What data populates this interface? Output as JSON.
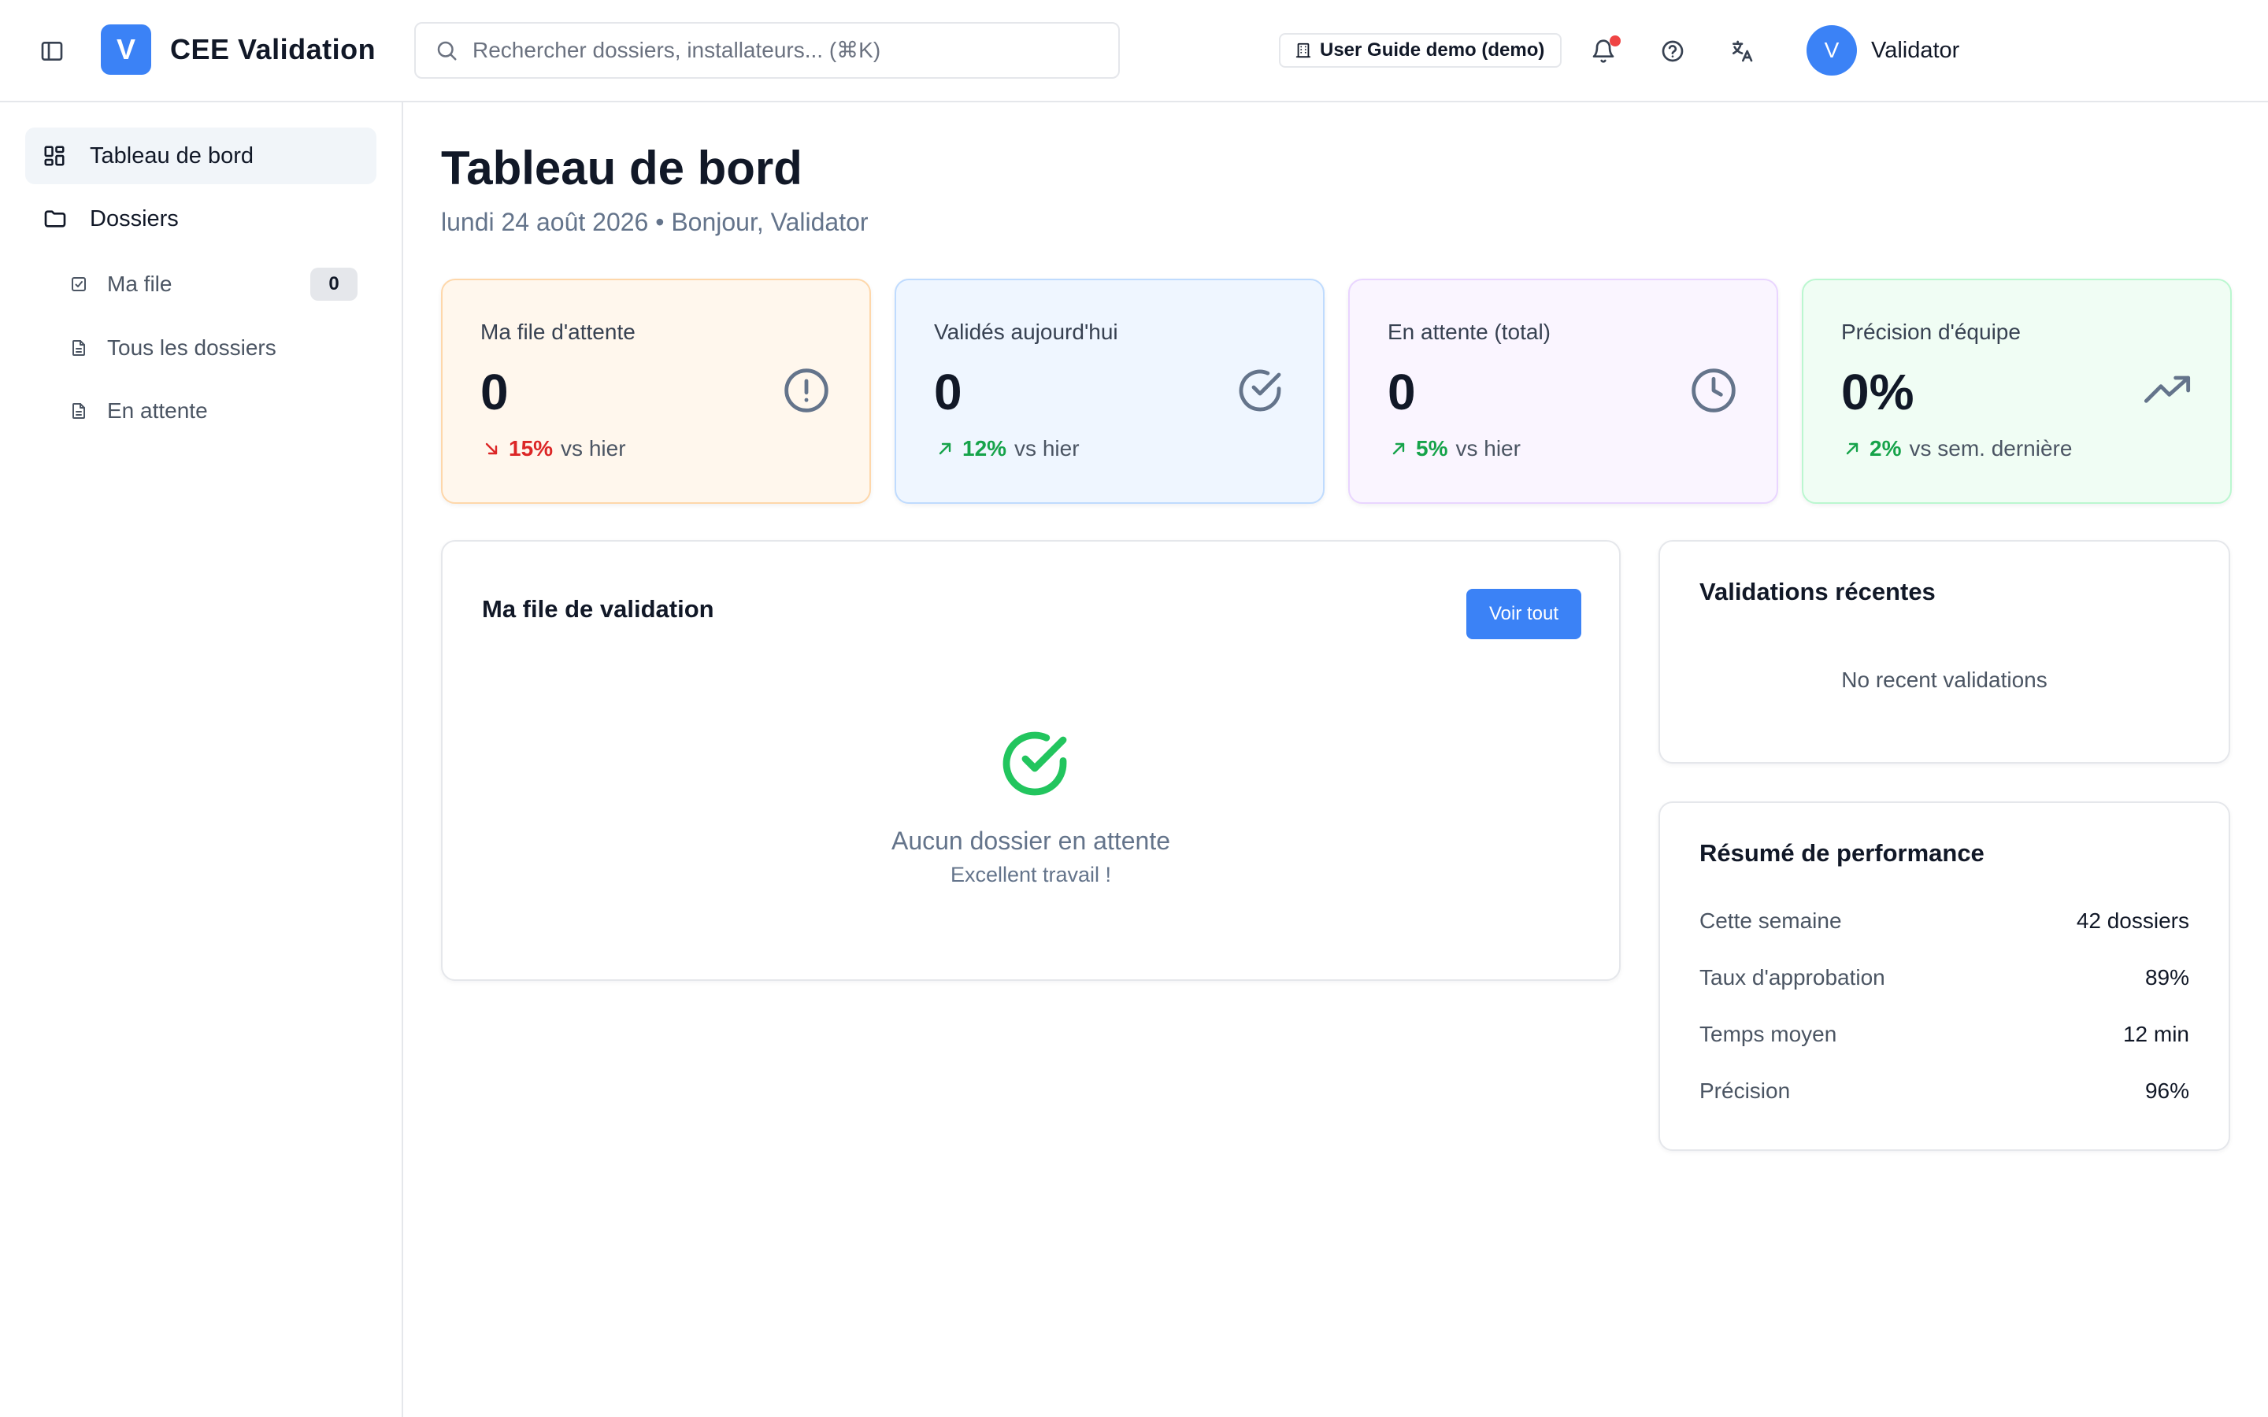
{
  "header": {
    "app_title": "CEE Validation",
    "logo_letter": "V",
    "search_placeholder": "Rechercher dossiers, installateurs... (⌘K)",
    "guide_label": "User Guide demo (demo)",
    "user_initial": "V",
    "user_name": "Validator",
    "notification_dot_color": "#ef4444",
    "icons": [
      "sidebar-toggle-icon",
      "search-icon",
      "building-icon",
      "bell-icon",
      "help-circle-icon",
      "translate-icon"
    ]
  },
  "sidebar": {
    "items": [
      {
        "label": "Tableau de bord",
        "icon": "dashboard-icon",
        "active": true
      },
      {
        "label": "Dossiers",
        "icon": "folder-icon"
      }
    ],
    "sub_items": [
      {
        "label": "Ma file",
        "icon": "checklist-icon",
        "badge": "0"
      },
      {
        "label": "Tous les dossiers",
        "icon": "file-icon"
      },
      {
        "label": "En attente",
        "icon": "file-icon"
      }
    ]
  },
  "page": {
    "title": "Tableau de bord",
    "subtitle": "lundi 24 août 2026 • Bonjour, Validator"
  },
  "stats": [
    {
      "label": "Ma file d'attente",
      "value": "0",
      "trend_value": "15%",
      "trend_text": "vs hier",
      "trend_dir": "down",
      "icon": "alert-circle-icon",
      "bg": "#fff7ed",
      "border": "#fed7aa",
      "trend_color": "#dc2626"
    },
    {
      "label": "Validés aujourd'hui",
      "value": "0",
      "trend_value": "12%",
      "trend_text": "vs hier",
      "trend_dir": "up",
      "icon": "check-circle-icon",
      "bg": "#eff6ff",
      "border": "#bfdbfe",
      "trend_color": "#16a34a"
    },
    {
      "label": "En attente (total)",
      "value": "0",
      "trend_value": "5%",
      "trend_text": "vs hier",
      "trend_dir": "up",
      "icon": "clock-icon",
      "bg": "#faf5ff",
      "border": "#e9d5ff",
      "trend_color": "#16a34a"
    },
    {
      "label": "Précision d'équipe",
      "value": "0%",
      "trend_value": "2%",
      "trend_text": "vs sem. dernière",
      "trend_dir": "up",
      "icon": "trending-up-icon",
      "bg": "#f0fdf4",
      "border": "#bbf7d0",
      "trend_color": "#16a34a"
    }
  ],
  "queue": {
    "title": "Ma file de validation",
    "button": "Voir tout",
    "empty_title": "Aucun dossier en attente",
    "empty_sub": "Excellent travail !",
    "accent": "#22c55e"
  },
  "recent": {
    "title": "Validations récentes",
    "empty": "No recent validations"
  },
  "performance": {
    "title": "Résumé de performance",
    "rows": [
      {
        "label": "Cette semaine",
        "value": "42 dossiers"
      },
      {
        "label": "Taux d'approbation",
        "value": "89%"
      },
      {
        "label": "Temps moyen",
        "value": "12 min"
      },
      {
        "label": "Précision",
        "value": "96%"
      }
    ]
  },
  "colors": {
    "accent": "#3b82f6",
    "text": "#111827",
    "muted": "#64748b",
    "border": "#e5e7eb"
  }
}
